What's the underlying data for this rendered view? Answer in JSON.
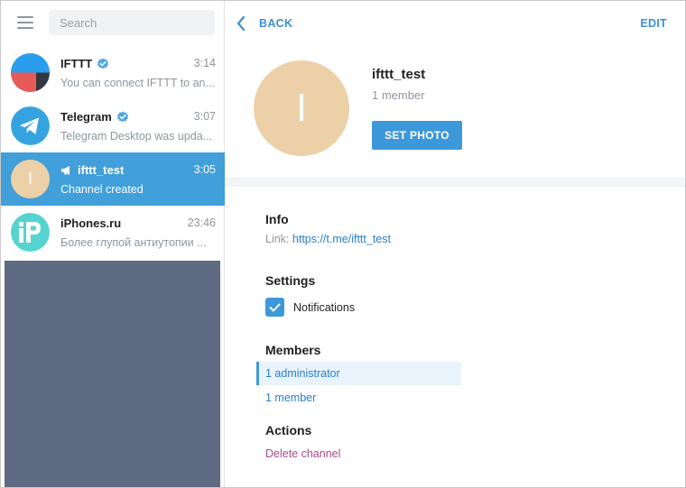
{
  "sidebar": {
    "search_placeholder": "Search",
    "chats": [
      {
        "title": "IFTTT",
        "time": "3:14",
        "preview": "You can connect IFTTT to an..."
      },
      {
        "title": "Telegram",
        "time": "3:07",
        "preview": "Telegram Desktop was upda..."
      },
      {
        "title": "ifttt_test",
        "time": "3:05",
        "preview": "Channel created",
        "avatar_letter": "I"
      },
      {
        "title": "iPhones.ru",
        "time": "23:46",
        "preview": "Более глупой антиутопии ..."
      }
    ]
  },
  "header": {
    "back_label": "BACK",
    "edit_label": "EDIT"
  },
  "profile": {
    "avatar_letter": "I",
    "name": "ifttt_test",
    "members": "1 member",
    "set_photo_label": "SET PHOTO"
  },
  "info": {
    "title": "Info",
    "link_prefix": "Link:",
    "link": "https://t.me/ifttt_test"
  },
  "settings": {
    "title": "Settings",
    "notifications_label": "Notifications"
  },
  "members_section": {
    "title": "Members",
    "administrators": "1 administrator",
    "members": "1 member"
  },
  "actions": {
    "title": "Actions",
    "delete_label": "Delete channel"
  },
  "colors": {
    "accent": "#419fd9",
    "link": "#2a7fc4",
    "avatar_beige": "#ecd0a8",
    "sidebar_empty": "#5f6b82",
    "delete": "#a94a8c"
  }
}
